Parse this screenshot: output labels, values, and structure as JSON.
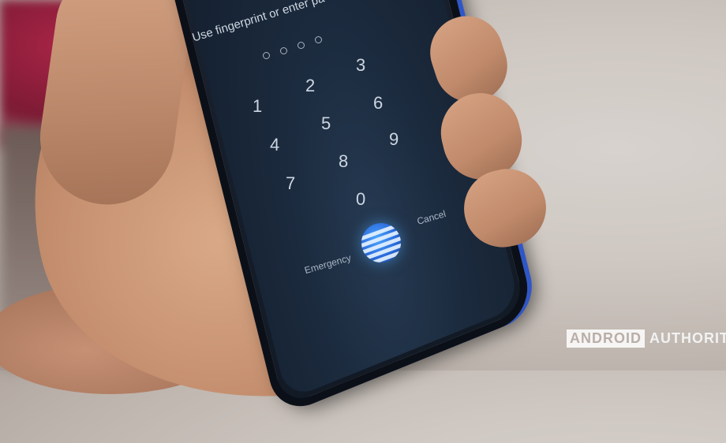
{
  "lockscreen": {
    "prompt": "Use fingerprint or enter pa",
    "pin_dots": 4,
    "keys": [
      "1",
      "2",
      "3",
      "4",
      "5",
      "6",
      "7",
      "8",
      "9",
      "0"
    ],
    "emergency_label": "Emergency",
    "cancel_label": "Cancel"
  },
  "watermark": {
    "part1": "ANDROID",
    "part2": "AUTHORITY"
  },
  "colors": {
    "phone_body": "#121a26",
    "phone_edge": "#2f56c9",
    "fingerprint_icon": "#2a6bdb",
    "background_red": "#a82446"
  }
}
